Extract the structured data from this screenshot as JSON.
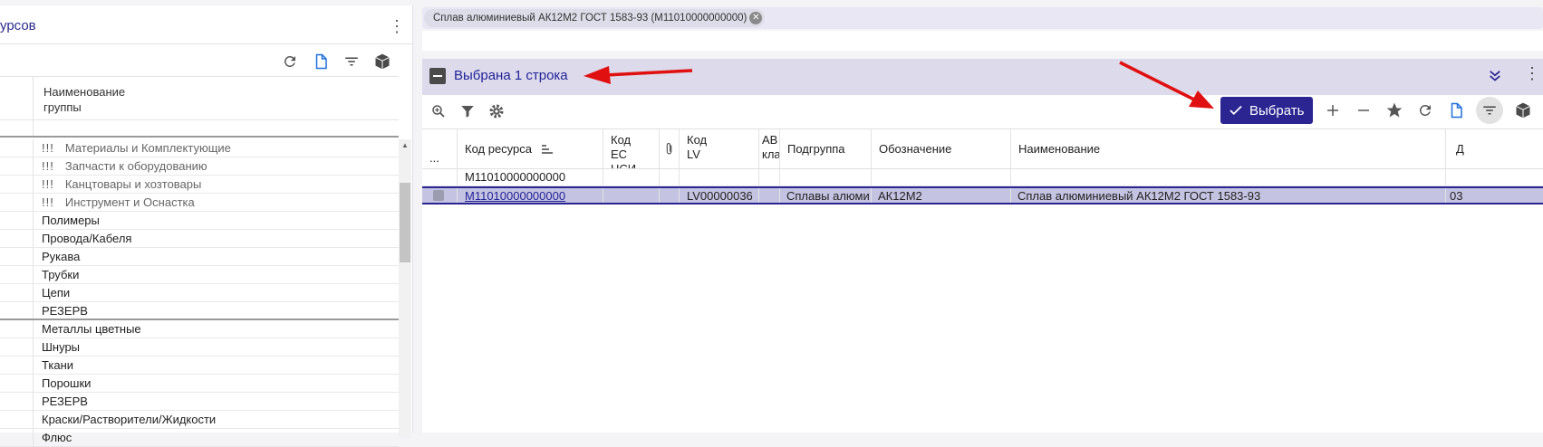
{
  "left_panel": {
    "title": "урсов",
    "column_header": "Наименование\nгруппы",
    "tree_items": [
      {
        "prefix": "!!!",
        "label": "Материалы и Комплектующие",
        "dim": true
      },
      {
        "prefix": "!!!",
        "label": "Запчасти к оборудованию",
        "dim": true
      },
      {
        "prefix": "!!!",
        "label": "Канцтовары и хозтовары",
        "dim": true
      },
      {
        "prefix": "!!!",
        "label": "Инструмент и Оснастка",
        "dim": true
      },
      {
        "prefix": "",
        "label": "Полимеры",
        "dim": false
      },
      {
        "prefix": "",
        "label": "Провода/Кабеля",
        "dim": false
      },
      {
        "prefix": "",
        "label": "Рукава",
        "dim": false
      },
      {
        "prefix": "",
        "label": "Трубки",
        "dim": false
      },
      {
        "prefix": "",
        "label": "Цепи",
        "dim": false
      },
      {
        "prefix": "",
        "label": "РЕЗЕРВ",
        "dim": false
      },
      {
        "prefix": "",
        "label": "Металлы цветные",
        "dim": false
      },
      {
        "prefix": "",
        "label": "Шнуры",
        "dim": false
      },
      {
        "prefix": "",
        "label": "Ткани",
        "dim": false
      },
      {
        "prefix": "",
        "label": "Порошки",
        "dim": false
      },
      {
        "prefix": "",
        "label": "РЕЗЕРВ",
        "dim": false
      },
      {
        "prefix": "",
        "label": "Краски/Растворители/Жидкости",
        "dim": false
      },
      {
        "prefix": "",
        "label": "Флюс",
        "dim": false
      }
    ]
  },
  "filter_chip": "Сплав алюминиевый АК12М2 ГОСТ 1583-93 (М11010000000000)",
  "panel": {
    "title": "Выбрана 1 строка",
    "select_button": "Выбрать"
  },
  "grid": {
    "columns": [
      {
        "label": "...",
        "key": "menu"
      },
      {
        "label": "Код ресурса",
        "key": "code"
      },
      {
        "label": "Код\nЕС НСИ",
        "key": "es"
      },
      {
        "label": "📎",
        "key": "attach"
      },
      {
        "label": "Код\nLV",
        "key": "lv"
      },
      {
        "label": "АВ\nкла",
        "key": "av"
      },
      {
        "label": "Подгруппа",
        "key": "sub"
      },
      {
        "label": "Обозначение",
        "key": "des"
      },
      {
        "label": "Наименование",
        "key": "name"
      },
      {
        "label": "Д",
        "key": "d"
      }
    ],
    "filter_value": "М11010000000000",
    "selected_row": {
      "code": "М11010000000000",
      "es": "",
      "lv": "LV00000036",
      "av": "",
      "sub": "Сплавы алюми",
      "des": "АК12М2",
      "name": "Сплав алюминиевый АК12М2 ГОСТ 1583-93",
      "d": "03"
    }
  },
  "colors": {
    "accent": "#2b2592",
    "header_bg": "#dcdaeb",
    "selected_row": "#c5c3e2",
    "annotation_arrow": "#e01010"
  }
}
